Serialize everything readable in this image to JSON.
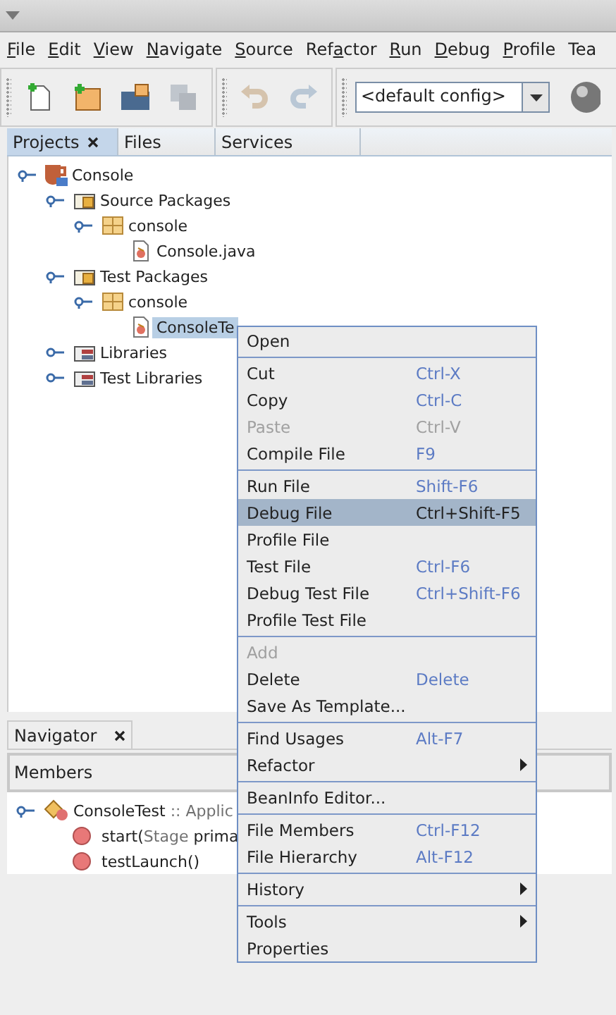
{
  "menubar": [
    {
      "label": "File"
    },
    {
      "label": "Edit"
    },
    {
      "label": "View"
    },
    {
      "label": "Navigate"
    },
    {
      "label": "Source"
    },
    {
      "label": "Refactor"
    },
    {
      "label": "Run"
    },
    {
      "label": "Debug"
    },
    {
      "label": "Profile"
    },
    {
      "label": "Tea"
    }
  ],
  "toolbar": {
    "buttons": [
      {
        "kind": "new-file",
        "disabled": false
      },
      {
        "kind": "new-project",
        "disabled": false
      },
      {
        "kind": "open-project",
        "disabled": false
      },
      {
        "kind": "save-all",
        "disabled": true
      },
      {
        "kind": "undo",
        "disabled": true
      },
      {
        "kind": "redo",
        "disabled": true
      }
    ],
    "config": "<default config>"
  },
  "tabs": [
    {
      "label": "Projects",
      "selected": true,
      "closable": true
    },
    {
      "label": "Files",
      "selected": false,
      "closable": false
    },
    {
      "label": "Services",
      "selected": false,
      "closable": false
    }
  ],
  "tree": [
    {
      "label": "Console",
      "kind": "project",
      "expanded": true,
      "selected": false,
      "children": [
        {
          "label": "Source Packages",
          "kind": "source-root",
          "expanded": true,
          "selected": false,
          "children": [
            {
              "label": "console",
              "kind": "package",
              "expanded": true,
              "selected": false,
              "children": [
                {
                  "label": "Console.java",
                  "kind": "java",
                  "selected": false
                }
              ]
            }
          ]
        },
        {
          "label": "Test Packages",
          "kind": "source-root",
          "expanded": true,
          "selected": false,
          "children": [
            {
              "label": "console",
              "kind": "package",
              "expanded": true,
              "selected": false,
              "children": [
                {
                  "label": "ConsoleTe",
                  "kind": "java",
                  "selected": true
                }
              ]
            }
          ]
        },
        {
          "label": "Libraries",
          "kind": "library",
          "expanded": false,
          "selected": false
        },
        {
          "label": "Test Libraries",
          "kind": "library",
          "expanded": false,
          "selected": false
        }
      ]
    }
  ],
  "navigator": {
    "tab": "Navigator",
    "filter": "Members",
    "root": {
      "name": "ConsoleTest",
      "type": " :: Applic",
      "children": [
        {
          "name": "start(",
          "param": "Stage",
          "rest": " prima"
        },
        {
          "name": "testLaunch()"
        }
      ]
    }
  },
  "context_menu": [
    [
      {
        "label": "Open",
        "disabled": false,
        "selected": false
      }
    ],
    [
      {
        "label": "Cut",
        "shortcut": "Ctrl-X",
        "disabled": false,
        "selected": false
      },
      {
        "label": "Copy",
        "shortcut": "Ctrl-C",
        "disabled": false,
        "selected": false
      },
      {
        "label": "Paste",
        "shortcut": "Ctrl-V",
        "disabled": true,
        "selected": false
      },
      {
        "label": "Compile File",
        "shortcut": "F9",
        "disabled": false,
        "selected": false
      }
    ],
    [
      {
        "label": "Run File",
        "shortcut": "Shift-F6",
        "disabled": false,
        "selected": false
      },
      {
        "label": "Debug File",
        "shortcut": "Ctrl+Shift-F5",
        "disabled": false,
        "selected": true
      },
      {
        "label": "Profile File",
        "disabled": false,
        "selected": false
      },
      {
        "label": "Test File",
        "shortcut": "Ctrl-F6",
        "disabled": false,
        "selected": false
      },
      {
        "label": "Debug Test File",
        "shortcut": "Ctrl+Shift-F6",
        "disabled": false,
        "selected": false
      },
      {
        "label": "Profile Test File",
        "disabled": false,
        "selected": false
      }
    ],
    [
      {
        "label": "Add",
        "disabled": true,
        "selected": false
      },
      {
        "label": "Delete",
        "shortcut": "Delete",
        "disabled": false,
        "selected": false
      },
      {
        "label": "Save As Template...",
        "disabled": false,
        "selected": false
      }
    ],
    [
      {
        "label": "Find Usages",
        "shortcut": "Alt-F7",
        "disabled": false,
        "selected": false
      },
      {
        "label": "Refactor",
        "submenu": true,
        "disabled": false,
        "selected": false
      }
    ],
    [
      {
        "label": "BeanInfo Editor...",
        "disabled": false,
        "selected": false
      }
    ],
    [
      {
        "label": "File Members",
        "shortcut": "Ctrl-F12",
        "disabled": false,
        "selected": false
      },
      {
        "label": "File Hierarchy",
        "shortcut": "Alt-F12",
        "disabled": false,
        "selected": false
      }
    ],
    [
      {
        "label": "History",
        "submenu": true,
        "disabled": false,
        "selected": false
      }
    ],
    [
      {
        "label": "Tools",
        "submenu": true,
        "disabled": false,
        "selected": false
      },
      {
        "label": "Properties",
        "disabled": false,
        "selected": false
      }
    ]
  ]
}
